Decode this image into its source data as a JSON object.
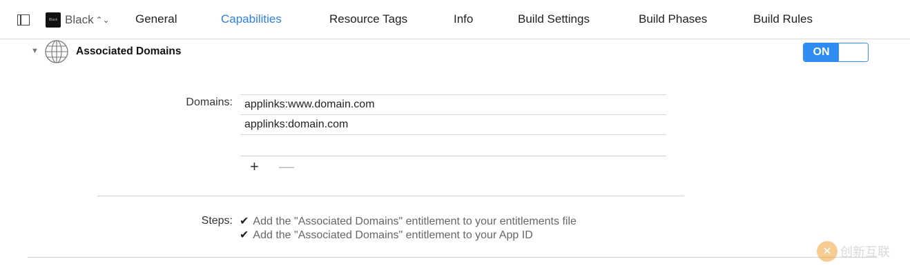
{
  "toolbar": {
    "target": {
      "icon_label": "Black",
      "name": "Black",
      "chevron": "⌃⌄"
    },
    "tabs": [
      {
        "label": "General"
      },
      {
        "label": "Capabilities"
      },
      {
        "label": "Resource Tags"
      },
      {
        "label": "Info"
      },
      {
        "label": "Build Settings"
      },
      {
        "label": "Build Phases"
      },
      {
        "label": "Build Rules"
      }
    ],
    "selected_tab": "Capabilities"
  },
  "section": {
    "title": "Associated Domains",
    "disclosure": "▼",
    "switch_label": "ON",
    "switch_on": true
  },
  "domains": {
    "label": "Domains:",
    "items": [
      "applinks:www.domain.com",
      "applinks:domain.com"
    ],
    "add_label": "+",
    "remove_label": "—"
  },
  "steps": {
    "label": "Steps:",
    "check_glyph": "✔",
    "items": [
      "Add the \"Associated Domains\" entitlement to your entitlements file",
      "Add the \"Associated Domains\" entitlement to your App ID"
    ]
  },
  "watermark": {
    "logo": "✕",
    "text": "创新互联"
  },
  "colors": {
    "accent": "#2f8cf0",
    "selected_tab": "#2d7fe0"
  }
}
